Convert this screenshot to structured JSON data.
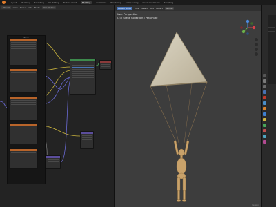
{
  "topbar": {
    "tabs": [
      "Layout",
      "Modeling",
      "Sculpting",
      "UV Editing",
      "Texture Paint",
      "Shading",
      "Animation",
      "Rendering",
      "Compositing",
      "Geometry Nodes",
      "Scripting"
    ],
    "active_tab": "Shading"
  },
  "node_editor": {
    "header_items": [
      "Object",
      "View",
      "Select",
      "Add",
      "Node",
      "Use Nodes"
    ],
    "frame_label": "Tissu"
  },
  "viewport": {
    "header_items": [
      "Object Mode",
      "View",
      "Select",
      "Add",
      "Object",
      "Global"
    ],
    "info_line1": "User Perspective",
    "info_line2": "(23) Scene Collection | Parachute",
    "status": "Version"
  },
  "colors": {
    "accent": "#4772b3",
    "node_orange": "#b8642a",
    "node_green": "#3d8a4c",
    "node_purple": "#5b4d9c",
    "viewport_bg": "#3d3d3d"
  }
}
